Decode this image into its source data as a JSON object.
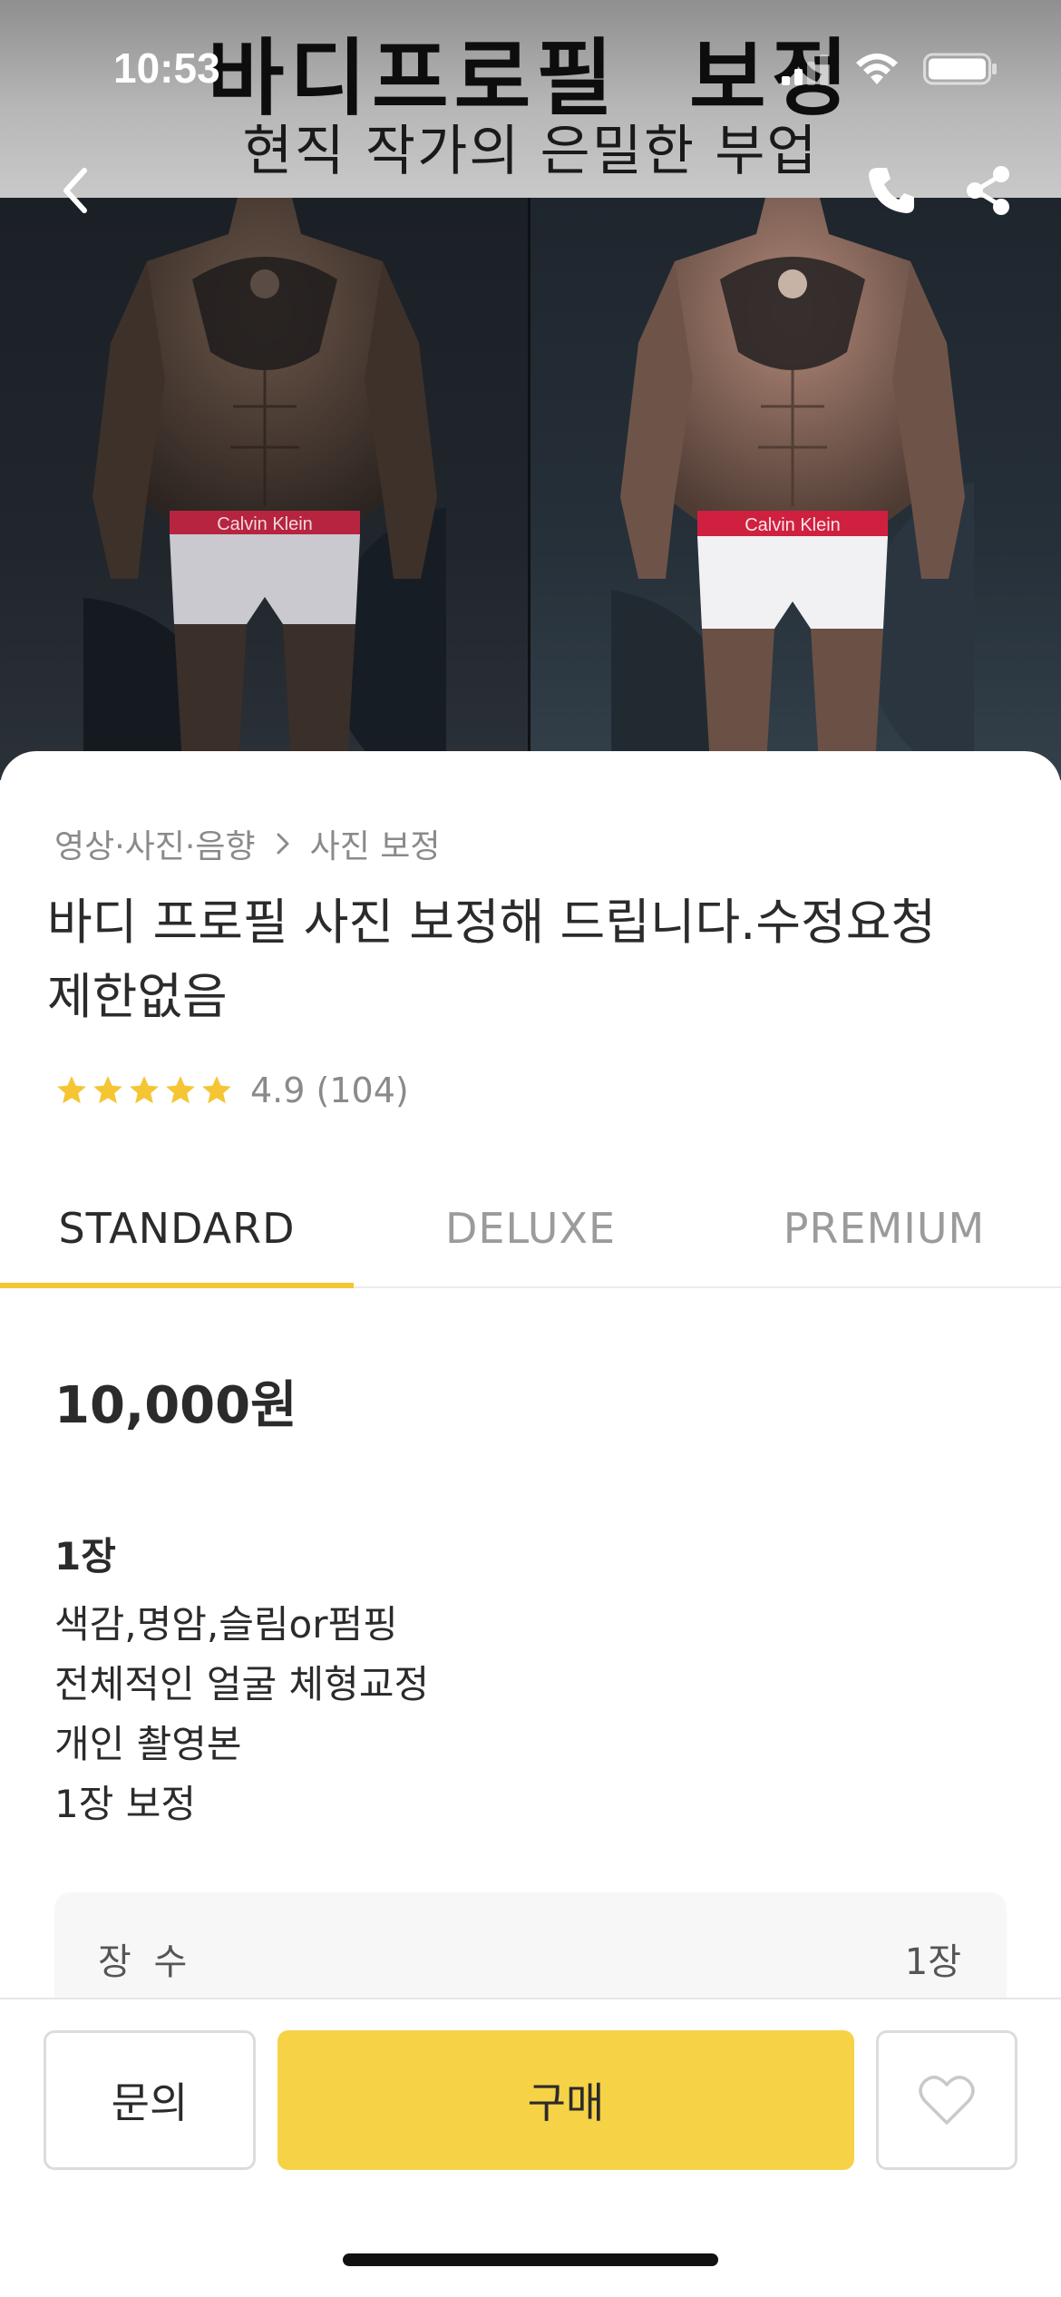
{
  "status_bar": {
    "time": "10:53"
  },
  "hero": {
    "banner_title": "바디프로필 보정",
    "banner_subtitle": "현직 작가의 은밀한 부업",
    "brand_text_left": "Calvin Klein",
    "brand_text_right": "Calvin Klein"
  },
  "nav": {
    "back_icon": "chevron-left-icon",
    "call_icon": "phone-icon",
    "share_icon": "share-icon"
  },
  "breadcrumb": {
    "category": "영상·사진·음향",
    "subcategory": "사진 보정"
  },
  "product": {
    "title_line1": "바디 프로필 사진 보정해 드립니다.수정요청",
    "title_line2": "제한없음",
    "rating": "4.9",
    "review_count": "(104)",
    "star_count": 5
  },
  "tabs": [
    {
      "label": "STANDARD",
      "active": true
    },
    {
      "label": "DELUXE",
      "active": false
    },
    {
      "label": "PREMIUM",
      "active": false
    }
  ],
  "package": {
    "price": "10,000원",
    "name": "1장",
    "lines": [
      "색감,명암,슬림or펌핑",
      "전체적인 얼굴 체형교정",
      "개인 촬영본",
      "1장 보정"
    ],
    "spec_label": "장 수",
    "spec_value": "1장"
  },
  "actions": {
    "inquiry_label": "문의",
    "buy_label": "구매",
    "like_icon": "heart-icon"
  },
  "colors": {
    "accent": "#f6d247",
    "tab_indicator": "#f5c534",
    "star": "#f5c534"
  }
}
